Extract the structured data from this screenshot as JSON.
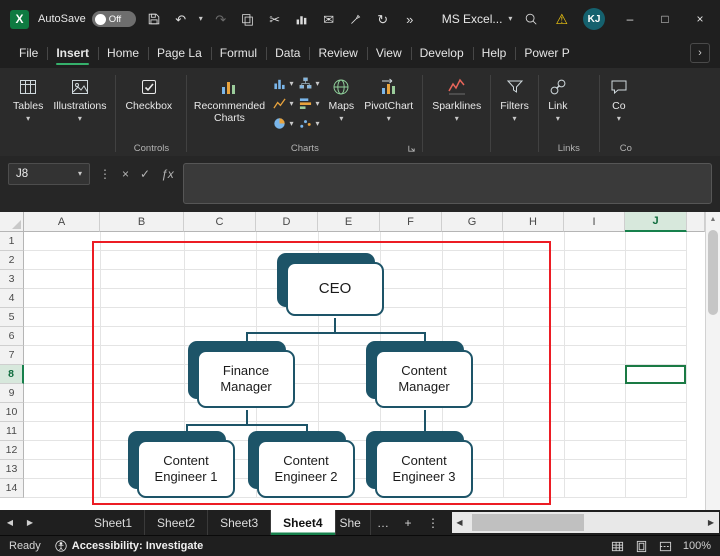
{
  "titlebar": {
    "app_logo": "X",
    "autosave_label": "AutoSave",
    "autosave_state": "Off",
    "document_title": "MS Excel...",
    "avatar_initials": "KJ"
  },
  "glyphs": {
    "chevron_down": "▾",
    "more_commands": "»",
    "ribbon_more": "›",
    "kebab": "⋮",
    "undo": "↶",
    "redo": "↷",
    "scissors": "✂",
    "mail": "✉",
    "refresh": "↻",
    "warning": "⚠",
    "minimize": "–",
    "maximize": "□",
    "close": "×",
    "cancel": "×",
    "check": "✓",
    "fx": "ƒx",
    "nav_left": "◀",
    "nav_right": "▶",
    "scroll_up": "▲",
    "ellipsis": "…",
    "plus": "+"
  },
  "ribbon_tabs": {
    "items": [
      "File",
      "Insert",
      "Home",
      "Page La",
      "Formul",
      "Data",
      "Review",
      "View",
      "Develop",
      "Help",
      "Power P"
    ],
    "active": "Insert"
  },
  "ribbon": {
    "tables": "Tables",
    "illustrations": "Illustrations",
    "checkbox": "Checkbox",
    "recommended_charts": "Recommended Charts",
    "maps": "Maps",
    "pivotchart": "PivotChart",
    "sparklines": "Sparklines",
    "filters": "Filters",
    "link": "Link",
    "comments": "Co",
    "labels": {
      "controls": "Controls",
      "charts": "Charts",
      "links": "Links",
      "comments": "Co"
    }
  },
  "formula_bar": {
    "cell_reference": "J8"
  },
  "grid": {
    "columns": [
      "A",
      "B",
      "C",
      "D",
      "E",
      "F",
      "G",
      "H",
      "I",
      "J"
    ],
    "rows": [
      "1",
      "2",
      "3",
      "4",
      "5",
      "6",
      "7",
      "8",
      "9",
      "10",
      "11",
      "12",
      "13",
      "14"
    ],
    "selected_cell": "J8"
  },
  "org_chart": {
    "nodes": [
      "CEO",
      "Finance Manager",
      "Content Manager",
      "Content Engineer 1",
      "Content Engineer 2",
      "Content Engineer 3"
    ],
    "accent_color": "#1d5468",
    "selection_color": "#ec1c24"
  },
  "sheet_tabs": {
    "items": [
      "Sheet1",
      "Sheet2",
      "Sheet3",
      "Sheet4",
      "She"
    ],
    "active": "Sheet4"
  },
  "status_bar": {
    "mode": "Ready",
    "accessibility": "Accessibility: Investigate",
    "zoom": "100%"
  }
}
